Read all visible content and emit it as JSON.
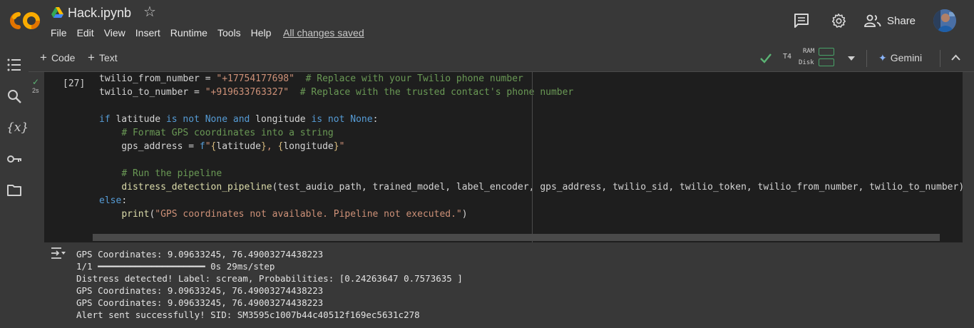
{
  "app": {
    "title": "Hack.ipynb",
    "logo_text": "CO",
    "star_glyph": "☆",
    "save_status": "All changes saved"
  },
  "menu": [
    "File",
    "Edit",
    "View",
    "Insert",
    "Runtime",
    "Tools",
    "Help"
  ],
  "header_actions": {
    "comments_icon": "comment-icon",
    "settings_icon": "gear-icon",
    "share_label": "Share"
  },
  "sidebar": {
    "items": [
      "table-of-contents-icon",
      "search-icon",
      "variables-icon",
      "secrets-key-icon",
      "files-folder-icon"
    ],
    "variables_glyph": "{x}"
  },
  "toolbar": {
    "code_label": "Code",
    "text_label": "Text",
    "plus_glyph": "+",
    "runtime_type": "T4",
    "ram_label": "RAM",
    "disk_label": "Disk",
    "gemini_label": "Gemini",
    "gemini_glyph": "✦"
  },
  "cell": {
    "exec_count": "[27]",
    "exec_time": "2s",
    "status": "completed",
    "code_lines": [
      [
        [
          "var",
          "twilio_from_number = "
        ],
        [
          "str",
          "\"+17754177698\""
        ],
        [
          "var",
          "  "
        ],
        [
          "cmt",
          "# Replace with your Twilio phone number"
        ]
      ],
      [
        [
          "var",
          "twilio_to_number = "
        ],
        [
          "str",
          "\"+919633763327\""
        ],
        [
          "var",
          "  "
        ],
        [
          "cmt",
          "# Replace with the trusted contact's phone number"
        ]
      ],
      [],
      [
        [
          "kw",
          "if"
        ],
        [
          "var",
          " latitude "
        ],
        [
          "kw",
          "is not"
        ],
        [
          "var",
          " "
        ],
        [
          "kw",
          "None"
        ],
        [
          "var",
          " "
        ],
        [
          "kw",
          "and"
        ],
        [
          "var",
          " longitude "
        ],
        [
          "kw",
          "is not"
        ],
        [
          "var",
          " "
        ],
        [
          "kw",
          "None"
        ],
        [
          "var",
          ":"
        ]
      ],
      [
        [
          "var",
          "    "
        ],
        [
          "cmt",
          "# Format GPS coordinates into a string"
        ]
      ],
      [
        [
          "var",
          "    gps_address = "
        ],
        [
          "kw",
          "f"
        ],
        [
          "str",
          "\""
        ],
        [
          "br",
          "{"
        ],
        [
          "var",
          "latitude"
        ],
        [
          "br",
          "}"
        ],
        [
          "str",
          ", "
        ],
        [
          "br",
          "{"
        ],
        [
          "var",
          "longitude"
        ],
        [
          "br",
          "}"
        ],
        [
          "str",
          "\""
        ]
      ],
      [],
      [
        [
          "var",
          "    "
        ],
        [
          "cmt",
          "# Run the pipeline"
        ]
      ],
      [
        [
          "var",
          "    "
        ],
        [
          "fn",
          "distress_detection_pipeline"
        ],
        [
          "var",
          "(test_audio_path, trained_model, label_encoder, gps_address, twilio_sid, twilio_token, twilio_from_number, twilio_to_number)"
        ]
      ],
      [
        [
          "kw",
          "else"
        ],
        [
          "var",
          ":"
        ]
      ],
      [
        [
          "var",
          "    "
        ],
        [
          "fn",
          "print"
        ],
        [
          "var",
          "("
        ],
        [
          "str",
          "\"GPS coordinates not available. Pipeline not executed.\""
        ],
        [
          "var",
          ")"
        ]
      ]
    ]
  },
  "output": {
    "lines": [
      "GPS Coordinates: 9.09633245, 76.49003274438223",
      "1/1 ━━━━━━━━━━━━━━━━━━━━ 0s 29ms/step",
      "Distress detected! Label: scream, Probabilities: [0.24263647 0.7573635 ]",
      "GPS Coordinates: 9.09633245, 76.49003274438223",
      "GPS Coordinates: 9.09633245, 76.49003274438223",
      "Alert sent successfully! SID: SM3595c1007b44c40512f169ec5631c278"
    ]
  },
  "colors": {
    "logo_orange": "#f9ab00",
    "logo_orange_dark": "#e37400",
    "accent_green": "#5bb374",
    "gemini_blue": "#8ab4f8"
  }
}
